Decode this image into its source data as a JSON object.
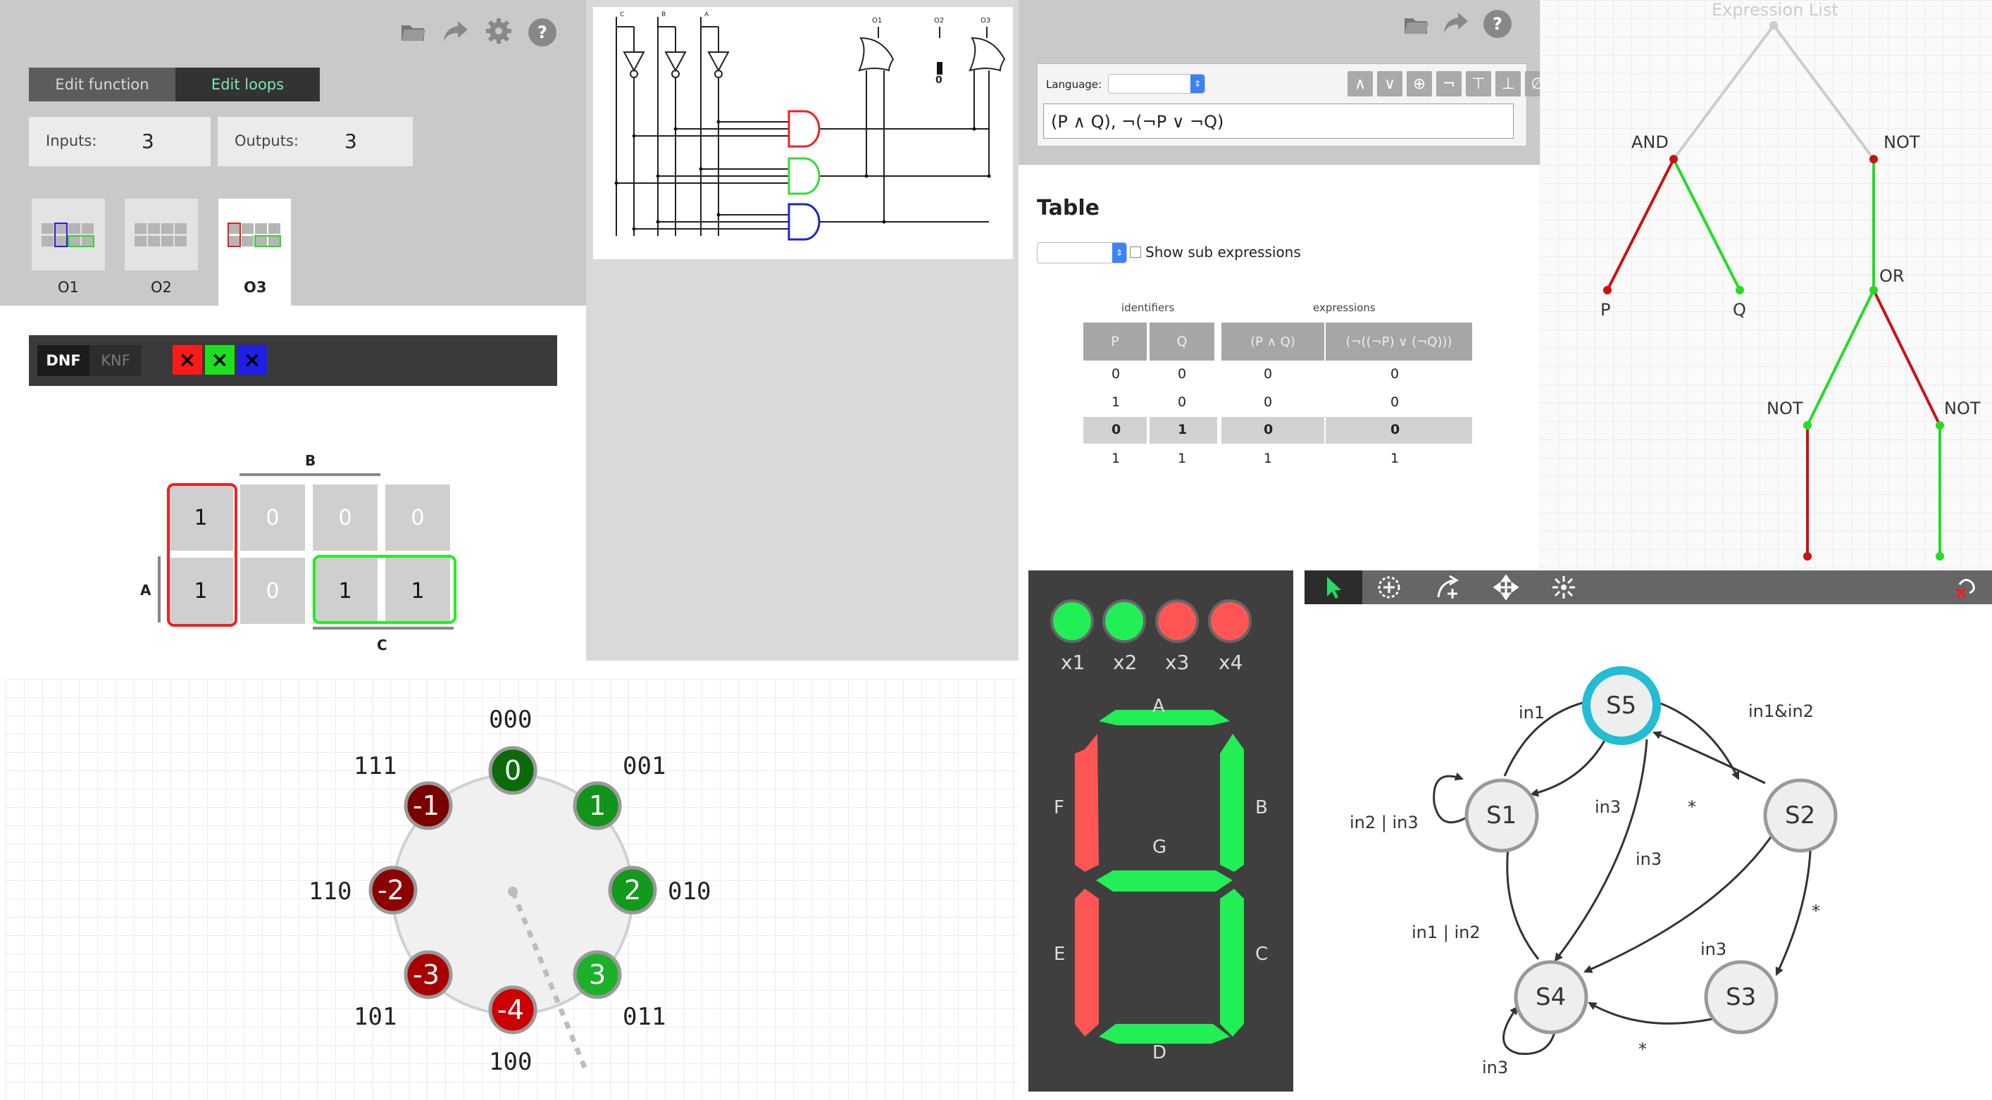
{
  "kmap_panel": {
    "tabs": {
      "function": "Edit function",
      "loops": "Edit loops"
    },
    "inputs": {
      "label": "Inputs:",
      "value": "3"
    },
    "outputs": {
      "label": "Outputs:",
      "value": "3"
    },
    "output_tabs": [
      "O1",
      "O2",
      "O3"
    ],
    "mode": {
      "dnf": "DNF",
      "knf": "KNF"
    },
    "color_swatches": [
      {
        "color": "#ff1a1a",
        "mark": "×"
      },
      {
        "color": "#1fe01f",
        "mark": "×"
      },
      {
        "color": "#1f1fe8",
        "mark": "×"
      }
    ],
    "var_labels": {
      "a": "A",
      "b": "B",
      "c": "C"
    },
    "cells": [
      "1",
      "0",
      "0",
      "0",
      "1",
      "0",
      "1",
      "1"
    ]
  },
  "circuit": {
    "inputs": [
      "C",
      "B",
      "A"
    ],
    "outputs": [
      "O1",
      "O2",
      "O3"
    ],
    "o2_value": "0"
  },
  "expression_panel": {
    "language_label": "Language:",
    "op_buttons": [
      "∧",
      "∨",
      "⊕",
      "¬",
      "⊤",
      "⊥",
      "∅"
    ],
    "expression": "(P ∧ Q), ¬(¬P ∨ ¬Q)",
    "table_title": "Table",
    "show_sub_label": "Show sub expressions",
    "group_headers": {
      "identifiers": "identifiers",
      "expressions": "expressions"
    },
    "columns": [
      "P",
      "Q",
      "(P ∧ Q)",
      "(¬((¬P) ∨ (¬Q)))"
    ],
    "rows": [
      [
        "0",
        "0",
        "0",
        "0"
      ],
      [
        "1",
        "0",
        "0",
        "0"
      ],
      [
        "0",
        "1",
        "0",
        "0"
      ],
      [
        "1",
        "1",
        "1",
        "1"
      ]
    ],
    "highlighted_row": 2
  },
  "tree_panel": {
    "title": "Expression List",
    "nodes": {
      "and": "AND",
      "not_top": "NOT",
      "p": "P",
      "q": "Q",
      "or": "OR",
      "not_left": "NOT",
      "not_right": "NOT"
    },
    "colors": {
      "true": "#22dd22",
      "false": "#cc1111",
      "neutral": "#cccccc"
    }
  },
  "number_circle": {
    "binary_labels": [
      "000",
      "001",
      "010",
      "011",
      "100",
      "101",
      "110",
      "111"
    ],
    "values": [
      "0",
      "1",
      "2",
      "3",
      "-4",
      "-3",
      "-2",
      "-1"
    ]
  },
  "seven_segment": {
    "leds": [
      {
        "label": "x1",
        "color": "#22ee55"
      },
      {
        "label": "x2",
        "color": "#22ee55"
      },
      {
        "label": "x3",
        "color": "#ff5555"
      },
      {
        "label": "x4",
        "color": "#ff5555"
      }
    ],
    "segments": {
      "A": "on",
      "B": "on",
      "C": "on",
      "D": "on",
      "E": "off",
      "F": "off",
      "G": "on"
    },
    "segment_labels": [
      "A",
      "B",
      "C",
      "D",
      "E",
      "F",
      "G"
    ]
  },
  "state_machine": {
    "toolbar_icons": [
      "select-icon",
      "add-state-icon",
      "add-transition-icon",
      "move-icon",
      "start-state-icon",
      "delete-icon"
    ],
    "states": [
      "S5",
      "S1",
      "S2",
      "S4",
      "S3"
    ],
    "transitions": [
      "in1",
      "in1&in2",
      "in3",
      "*",
      "in2 | in3",
      "in3",
      "*",
      "in1 | in2",
      "in3",
      "in3",
      "*"
    ]
  }
}
